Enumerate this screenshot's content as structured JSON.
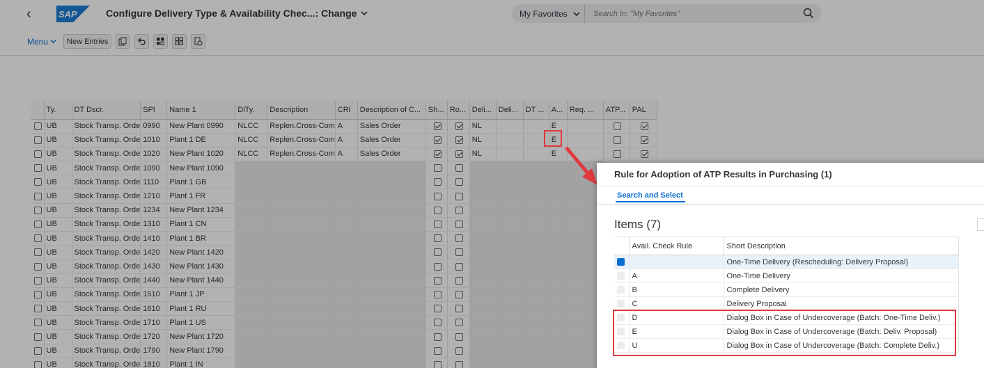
{
  "shell": {
    "title": "Configure Delivery Type & Availability Chec...: Change",
    "logo_text": "SAP",
    "search_scope": "My Favorites",
    "search_placeholder": "Search In: \"My Favorites\""
  },
  "toolbar": {
    "menu_label": "Menu",
    "new_entries_label": "New Entries"
  },
  "table": {
    "columns": [
      "Ty.",
      "DT Dscr.",
      "SPl",
      "Name 1",
      "DlTy.",
      "Description",
      "CRl",
      "Description of C...",
      "Sh...",
      "Ro...",
      "Deli...",
      "Deli...",
      "DT ...",
      "A...",
      "Req. ...",
      "ATP...",
      "PAL"
    ],
    "rows": [
      {
        "ty": "UB",
        "dt": "Stock Transp. Orde",
        "spl": "0990",
        "name": "New Plant 0990",
        "dlty": "NLCC",
        "desc": "Replen.Cross-Com",
        "crl": "A",
        "descc": "Sales Order",
        "sh": true,
        "ro": true,
        "deli": "NL",
        "a": "E",
        "atp": false,
        "pal": true
      },
      {
        "ty": "UB",
        "dt": "Stock Transp. Orde",
        "spl": "1010",
        "name": "Plant 1 DE",
        "dlty": "NLCC",
        "desc": "Replen.Cross-Com",
        "crl": "A",
        "descc": "Sales Order",
        "sh": true,
        "ro": true,
        "deli": "NL",
        "a": "E",
        "atp": false,
        "pal": true
      },
      {
        "ty": "UB",
        "dt": "Stock Transp. Orde",
        "spl": "1020",
        "name": "New Plant 1020",
        "dlty": "NLCC",
        "desc": "Replen.Cross-Com",
        "crl": "A",
        "descc": "Sales Order",
        "sh": true,
        "ro": true,
        "deli": "NL",
        "a": "E",
        "atp": false,
        "pal": true
      },
      {
        "ty": "UB",
        "dt": "Stock Transp. Orde",
        "spl": "1090",
        "name": "New Plant 1090",
        "dlty": "",
        "desc": "",
        "crl": "",
        "descc": "",
        "sh": false,
        "ro": false,
        "deli": "",
        "a": "",
        "atp": false,
        "pal": false
      },
      {
        "ty": "UB",
        "dt": "Stock Transp. Orde",
        "spl": "1110",
        "name": "Plant 1 GB",
        "dlty": "",
        "desc": "",
        "crl": "",
        "descc": "",
        "sh": false,
        "ro": false,
        "deli": "",
        "a": "",
        "atp": false,
        "pal": false
      },
      {
        "ty": "UB",
        "dt": "Stock Transp. Orde",
        "spl": "1210",
        "name": "Plant 1 FR",
        "dlty": "",
        "desc": "",
        "crl": "",
        "descc": "",
        "sh": false,
        "ro": false,
        "deli": "",
        "a": "",
        "atp": false,
        "pal": false
      },
      {
        "ty": "UB",
        "dt": "Stock Transp. Orde",
        "spl": "1234",
        "name": "New Plant 1234",
        "dlty": "",
        "desc": "",
        "crl": "",
        "descc": "",
        "sh": false,
        "ro": false,
        "deli": "",
        "a": "",
        "atp": false,
        "pal": false
      },
      {
        "ty": "UB",
        "dt": "Stock Transp. Orde",
        "spl": "1310",
        "name": "Plant 1 CN",
        "dlty": "",
        "desc": "",
        "crl": "",
        "descc": "",
        "sh": false,
        "ro": false,
        "deli": "",
        "a": "",
        "atp": false,
        "pal": false
      },
      {
        "ty": "UB",
        "dt": "Stock Transp. Orde",
        "spl": "1410",
        "name": "Plant 1 BR",
        "dlty": "",
        "desc": "",
        "crl": "",
        "descc": "",
        "sh": false,
        "ro": false,
        "deli": "",
        "a": "",
        "atp": false,
        "pal": false
      },
      {
        "ty": "UB",
        "dt": "Stock Transp. Orde",
        "spl": "1420",
        "name": "New Plant 1420",
        "dlty": "",
        "desc": "",
        "crl": "",
        "descc": "",
        "sh": false,
        "ro": false,
        "deli": "",
        "a": "",
        "atp": false,
        "pal": false
      },
      {
        "ty": "UB",
        "dt": "Stock Transp. Orde",
        "spl": "1430",
        "name": "New Plant 1430",
        "dlty": "",
        "desc": "",
        "crl": "",
        "descc": "",
        "sh": false,
        "ro": false,
        "deli": "",
        "a": "",
        "atp": false,
        "pal": false
      },
      {
        "ty": "UB",
        "dt": "Stock Transp. Orde",
        "spl": "1440",
        "name": "New Plant 1440",
        "dlty": "",
        "desc": "",
        "crl": "",
        "descc": "",
        "sh": false,
        "ro": false,
        "deli": "",
        "a": "",
        "atp": false,
        "pal": false
      },
      {
        "ty": "UB",
        "dt": "Stock Transp. Orde",
        "spl": "1510",
        "name": "Plant 1 JP",
        "dlty": "",
        "desc": "",
        "crl": "",
        "descc": "",
        "sh": false,
        "ro": false,
        "deli": "",
        "a": "",
        "atp": false,
        "pal": false
      },
      {
        "ty": "UB",
        "dt": "Stock Transp. Orde",
        "spl": "1610",
        "name": "Plant 1 RU",
        "dlty": "",
        "desc": "",
        "crl": "",
        "descc": "",
        "sh": false,
        "ro": false,
        "deli": "",
        "a": "",
        "atp": false,
        "pal": false
      },
      {
        "ty": "UB",
        "dt": "Stock Transp. Orde",
        "spl": "1710",
        "name": "Plant 1 US",
        "dlty": "",
        "desc": "",
        "crl": "",
        "descc": "",
        "sh": false,
        "ro": false,
        "deli": "",
        "a": "",
        "atp": false,
        "pal": false
      },
      {
        "ty": "UB",
        "dt": "Stock Transp. Orde",
        "spl": "1720",
        "name": "New Plant 1720",
        "dlty": "",
        "desc": "",
        "crl": "",
        "descc": "",
        "sh": false,
        "ro": false,
        "deli": "",
        "a": "",
        "atp": false,
        "pal": false
      },
      {
        "ty": "UB",
        "dt": "Stock Transp. Orde",
        "spl": "1790",
        "name": "New Plant 1790",
        "dlty": "",
        "desc": "",
        "crl": "",
        "descc": "",
        "sh": false,
        "ro": false,
        "deli": "",
        "a": "",
        "atp": false,
        "pal": false
      },
      {
        "ty": "UB",
        "dt": "Stock Transp. Orde",
        "spl": "1810",
        "name": "Plant 1 IN",
        "dlty": "",
        "desc": "",
        "crl": "",
        "descc": "",
        "sh": false,
        "ro": false,
        "deli": "",
        "a": "",
        "atp": false,
        "pal": false
      }
    ]
  },
  "dialog": {
    "title": "Rule for Adoption of ATP Results in Purchasing (1)",
    "tab": "Search and Select",
    "items_title": "Items (7)",
    "columns": [
      "Avail. Check Rule",
      "Short Description"
    ],
    "rows": [
      {
        "rule": "",
        "desc": "One-Time Delivery (Rescheduling: Delivery Proposal)",
        "selected": true
      },
      {
        "rule": "A",
        "desc": "One-Time Delivery",
        "selected": false
      },
      {
        "rule": "B",
        "desc": "Complete Delivery",
        "selected": false
      },
      {
        "rule": "C",
        "desc": "Delivery Proposal",
        "selected": false
      },
      {
        "rule": "D",
        "desc": "Dialog Box in Case of Undercoverage (Batch: One-Time Deliv.)",
        "selected": false
      },
      {
        "rule": "E",
        "desc": "Dialog Box in Case of Undercoverage (Batch: Deliv. Proposal)",
        "selected": false
      },
      {
        "rule": "U",
        "desc": "Dialog Box in Case of Undercoverage (Batch: Complete Deliv.)",
        "selected": false
      }
    ]
  },
  "colors": {
    "accent": "#0a6ed1",
    "highlight": "#e0393e"
  }
}
